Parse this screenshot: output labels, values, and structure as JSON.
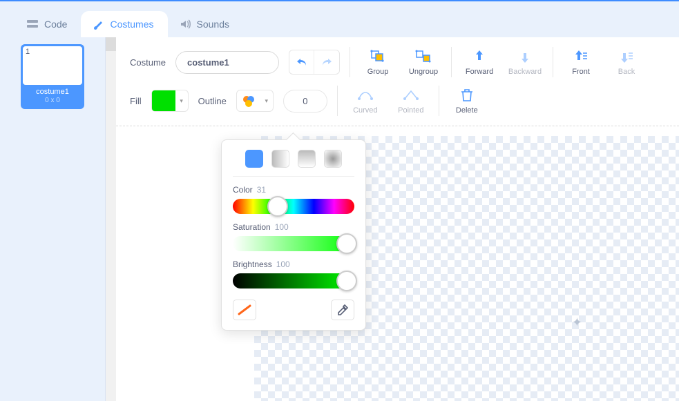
{
  "tabs": {
    "code": "Code",
    "costumes": "Costumes",
    "sounds": "Sounds"
  },
  "costume_thumb": {
    "index": "1",
    "name": "costume1",
    "size": "0 x 0"
  },
  "toolbar": {
    "costume_label": "Costume",
    "costume_name": "costume1",
    "fill_label": "Fill",
    "fill_color": "#00e000",
    "outline_label": "Outline",
    "outline_width": "0",
    "group": "Group",
    "ungroup": "Ungroup",
    "forward": "Forward",
    "backward": "Backward",
    "front": "Front",
    "back": "Back",
    "curved": "Curved",
    "pointed": "Pointed",
    "delete": "Delete"
  },
  "color_picker": {
    "color_label": "Color",
    "color_value": "31",
    "saturation_label": "Saturation",
    "saturation_value": "100",
    "brightness_label": "Brightness",
    "brightness_value": "100"
  }
}
